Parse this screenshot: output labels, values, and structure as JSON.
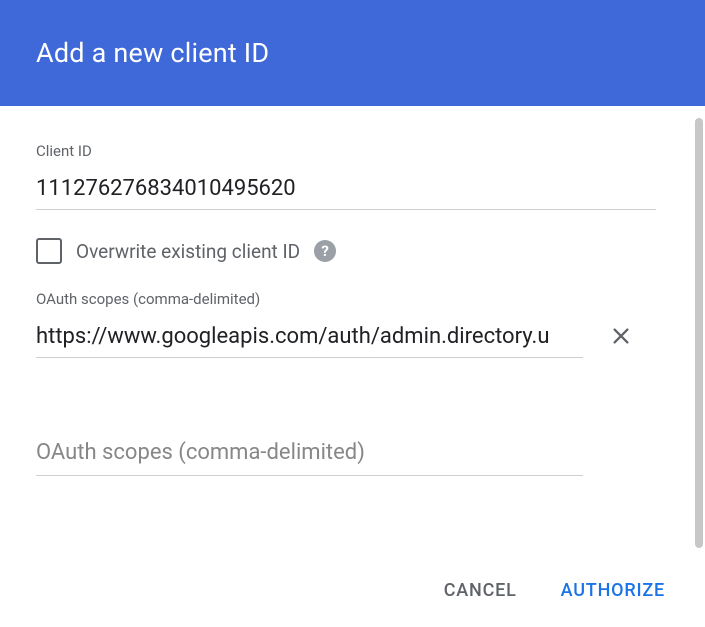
{
  "header": {
    "title": "Add a new client ID"
  },
  "clientId": {
    "label": "Client ID",
    "value": "111276276834010495620"
  },
  "overwrite": {
    "label": "Overwrite existing client ID",
    "checked": false,
    "helpIcon": "?"
  },
  "scopes": {
    "label": "OAuth scopes (comma-delimited)",
    "value": "https://www.googleapis.com/auth/admin.directory.u",
    "placeholder": "OAuth scopes (comma-delimited)"
  },
  "footer": {
    "cancel": "CANCEL",
    "authorize": "AUTHORIZE"
  }
}
